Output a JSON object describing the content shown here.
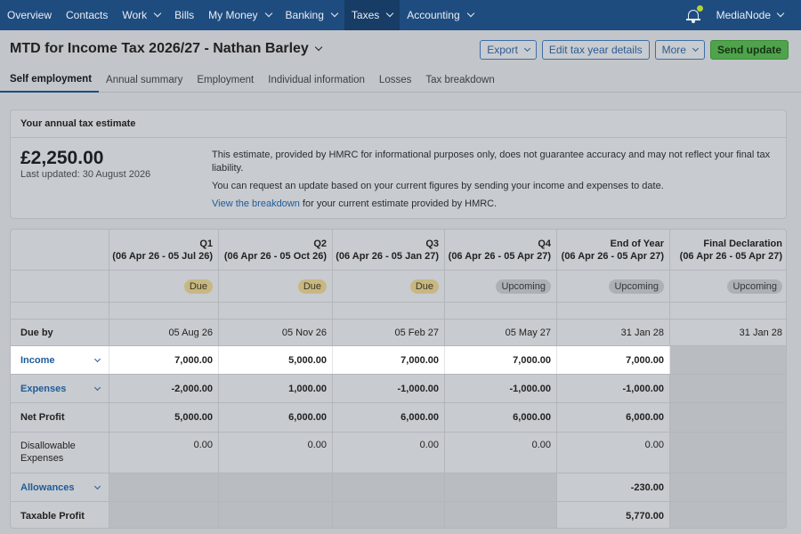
{
  "nav": {
    "items": [
      {
        "label": "Overview",
        "dropdown": false,
        "active": false
      },
      {
        "label": "Contacts",
        "dropdown": false,
        "active": false
      },
      {
        "label": "Work",
        "dropdown": true,
        "active": false
      },
      {
        "label": "Bills",
        "dropdown": false,
        "active": false
      },
      {
        "label": "My Money",
        "dropdown": true,
        "active": false
      },
      {
        "label": "Banking",
        "dropdown": true,
        "active": false
      },
      {
        "label": "Taxes",
        "dropdown": true,
        "active": true
      },
      {
        "label": "Accounting",
        "dropdown": true,
        "active": false
      }
    ],
    "org_name": "MediaNode"
  },
  "header": {
    "title": "MTD for Income Tax 2026/27 - Nathan Barley",
    "buttons": {
      "export": "Export",
      "edit": "Edit tax year details",
      "more": "More",
      "send": "Send update"
    }
  },
  "tabs": [
    "Self employment",
    "Annual summary",
    "Employment",
    "Individual information",
    "Losses",
    "Tax breakdown"
  ],
  "estimate": {
    "heading": "Your annual tax estimate",
    "amount": "£2,250.00",
    "updated": "Last updated: 30 August 2026",
    "note1": "This estimate, provided by HMRC for informational purposes only, does not guarantee accuracy and may not reflect your final tax liability.",
    "note2": "You can request an update based on your current figures by sending your income and expenses to date.",
    "link": "View the breakdown",
    "note3": " for your current estimate provided by HMRC."
  },
  "table": {
    "columns": [
      {
        "name": "Q1",
        "range": "(06 Apr 26 - 05 Jul 26)",
        "status": "Due"
      },
      {
        "name": "Q2",
        "range": "(06 Apr 26 - 05 Oct 26)",
        "status": "Due"
      },
      {
        "name": "Q3",
        "range": "(06 Apr 26 - 05 Jan 27)",
        "status": "Due"
      },
      {
        "name": "Q4",
        "range": "(06 Apr 26 - 05 Apr 27)",
        "status": "Upcoming"
      },
      {
        "name": "End of Year",
        "range": "(06 Apr 26 - 05 Apr 27)",
        "status": "Upcoming"
      },
      {
        "name": "Final Declaration",
        "range": "(06 Apr 26 - 05 Apr 27)",
        "status": "Upcoming"
      }
    ],
    "due_by": {
      "label": "Due by",
      "values": [
        "05 Aug 26",
        "05 Nov 26",
        "05 Feb 27",
        "05 May 27",
        "31 Jan 28",
        "31 Jan 28"
      ]
    },
    "income": {
      "label": "Income",
      "values": [
        "7,000.00",
        "5,000.00",
        "7,000.00",
        "7,000.00",
        "7,000.00",
        ""
      ]
    },
    "expenses": {
      "label": "Expenses",
      "values": [
        "-2,000.00",
        "1,000.00",
        "-1,000.00",
        "-1,000.00",
        "-1,000.00",
        ""
      ]
    },
    "net_profit": {
      "label": "Net Profit",
      "values": [
        "5,000.00",
        "6,000.00",
        "6,000.00",
        "6,000.00",
        "6,000.00",
        ""
      ]
    },
    "disallowable": {
      "label": "Disallowable Expenses",
      "values": [
        "0.00",
        "0.00",
        "0.00",
        "0.00",
        "0.00",
        ""
      ]
    },
    "allowances": {
      "label": "Allowances",
      "values": [
        "",
        "",
        "",
        "",
        "-230.00",
        ""
      ]
    },
    "taxable": {
      "label": "Taxable Profit",
      "values": [
        "",
        "",
        "",
        "",
        "5,770.00",
        ""
      ]
    }
  }
}
